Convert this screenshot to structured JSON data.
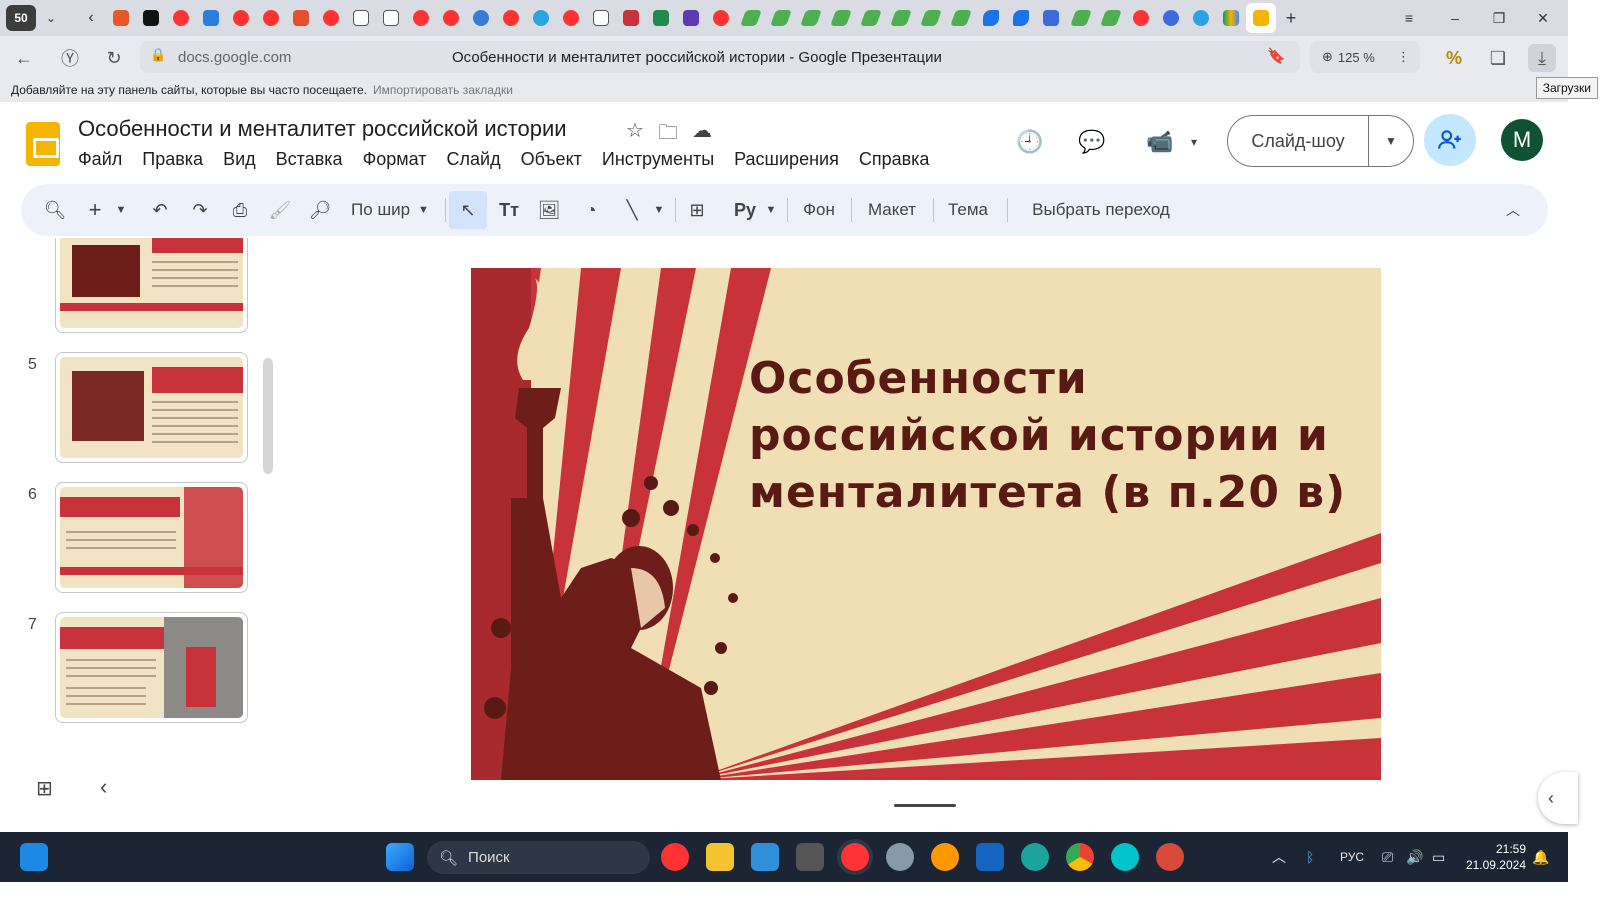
{
  "browser": {
    "tab_count": "50",
    "address_host": "docs.google.com",
    "page_title": "Особенности и менталитет российской истории - Google Презентации",
    "zoom": "125 %",
    "bookmarks_prompt": "Добавляйте на эту панель сайты, которые вы часто посещаете.",
    "bookmarks_import": "Импортировать закладки",
    "downloads_tooltip": "Загрузки"
  },
  "docs": {
    "title": "Особенности и менталитет российской истории",
    "menu": [
      "Файл",
      "Правка",
      "Вид",
      "Вставка",
      "Формат",
      "Слайд",
      "Объект",
      "Инструменты",
      "Расширения",
      "Справка"
    ],
    "slideshow_label": "Слайд-шоу",
    "avatar_letter": "M"
  },
  "toolbar": {
    "zoom_label": "По шир",
    "background": "Фон",
    "layout": "Макет",
    "theme": "Тема",
    "transition": "Выбрать переход"
  },
  "filmstrip": {
    "numbers": [
      "5",
      "6",
      "7"
    ]
  },
  "slide": {
    "title": "Особенности российской истории и менталитета (в п.20 в)"
  },
  "taskbar": {
    "search": "Поиск",
    "lang": "РУС",
    "time": "21:59",
    "date": "21.09.2024"
  },
  "colors": {
    "slide_red": "#c8323a",
    "slide_dark": "#6e1e1a",
    "slide_cream": "#f0dfb5",
    "accent_blue": "#c2e7ff"
  }
}
